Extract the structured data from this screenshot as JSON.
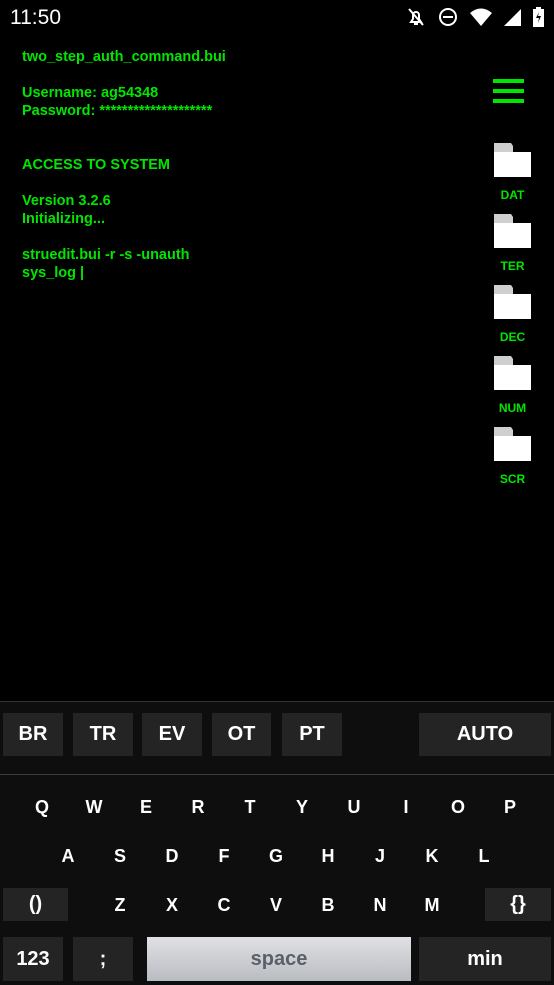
{
  "status_bar": {
    "time": "11:50",
    "icons": [
      "bell-off-icon",
      "do-not-disturb-icon",
      "wifi-icon",
      "signal-icon",
      "battery-charging-icon"
    ]
  },
  "terminal": {
    "lines": [
      "two_step_auth_command.bui",
      "Username: ag54348",
      "Password: ********************",
      "ACCESS TO SYSTEM",
      "Version 3.2.6",
      "Initializing...",
      "struedit.bui -r -s -unauth",
      "sys_log |"
    ]
  },
  "sidebar": {
    "folders": [
      "DAT",
      "TER",
      "DEC",
      "NUM",
      "SCR"
    ]
  },
  "colors": {
    "accent": "#00e600",
    "background": "#000000"
  },
  "toolbar": {
    "buttons": [
      "BR",
      "TR",
      "EV",
      "OT",
      "PT"
    ],
    "auto": "AUTO"
  },
  "keyboard": {
    "row1": [
      "Q",
      "W",
      "E",
      "R",
      "T",
      "Y",
      "U",
      "I",
      "O",
      "P"
    ],
    "row2": [
      "A",
      "S",
      "D",
      "F",
      "G",
      "H",
      "J",
      "K",
      "L"
    ],
    "row3": [
      "Z",
      "X",
      "C",
      "V",
      "B",
      "N",
      "M"
    ],
    "paren": "()",
    "brace": "{}",
    "num": "123",
    "semicolon": ";",
    "space": "space",
    "min": "min"
  }
}
